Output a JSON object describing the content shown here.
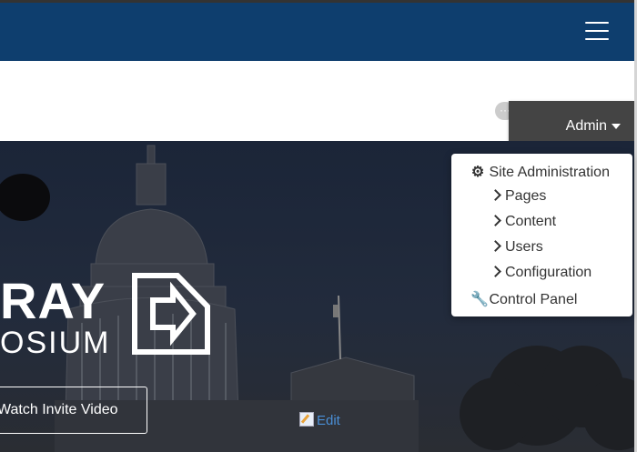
{
  "header": {
    "menu_icon": "hamburger-icon"
  },
  "admin_menu": {
    "label": "Admin",
    "items": [
      {
        "label": "Site Administration",
        "icon": "gear-icon"
      },
      {
        "label": "Pages",
        "icon": "chevron-right-icon"
      },
      {
        "label": "Content",
        "icon": "chevron-right-icon"
      },
      {
        "label": "Users",
        "icon": "chevron-right-icon"
      },
      {
        "label": "Configuration",
        "icon": "chevron-right-icon"
      },
      {
        "label": "Control Panel",
        "icon": "wrench-icon"
      }
    ]
  },
  "hero": {
    "logo_line1": "RAY",
    "logo_line2": "OSIUM",
    "watch_button": "Watch Invite Video",
    "edit_link": "Edit"
  },
  "colors": {
    "header": "#0e3e6e",
    "admin_tab": "#444444",
    "link": "#4a8fd6"
  }
}
